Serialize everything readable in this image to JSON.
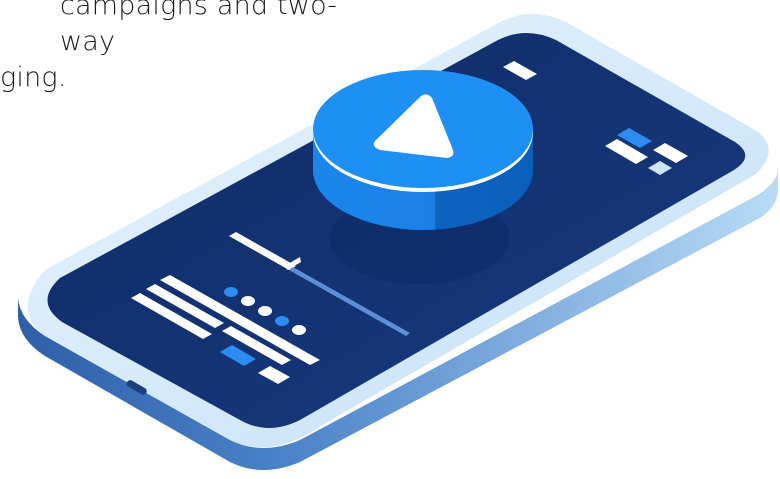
{
  "caption": {
    "line1": "campaigns and two-way",
    "line2": "ging."
  },
  "icons": {
    "device": "smartphone-illustration",
    "play": "play-icon"
  },
  "colors": {
    "screen": "#12306e",
    "bezel_light": "#d8ecfb",
    "bezel_mid": "#a9cff1",
    "bezel_dark": "#3f73b6",
    "button_top": "#1e90f5",
    "button_side": "#0b66c8",
    "accent_blue": "#2c8cf0",
    "white": "#ffffff"
  }
}
